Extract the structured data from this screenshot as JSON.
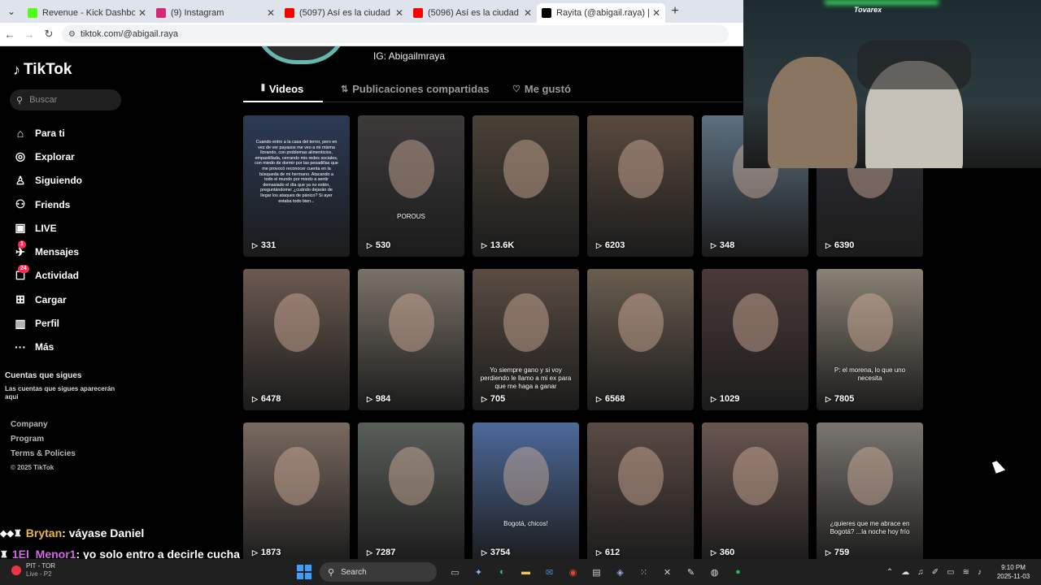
{
  "browser": {
    "tabs": [
      {
        "label": "Revenue - Kick Dashboard",
        "fav_color": "#53fc18"
      },
      {
        "label": "(9) Instagram",
        "fav_color": "#d62976"
      },
      {
        "label": "(5097) Así es la ciudad más FUTU",
        "fav_color": "#ff0000"
      },
      {
        "label": "(5096) Así es la ciudad más FUTU",
        "fav_color": "#ff0000"
      },
      {
        "label": "Rayita (@abigail.raya) | TikTok",
        "fav_color": "#000000"
      }
    ],
    "url": "tiktok.com/@abigail.raya"
  },
  "sidebar": {
    "brand": "TikTok",
    "search_placeholder": "Buscar",
    "nav": [
      {
        "label": "Para ti",
        "icon": "home-icon",
        "glyph": "⌂"
      },
      {
        "label": "Explorar",
        "icon": "compass-icon",
        "glyph": "◎"
      },
      {
        "label": "Siguiendo",
        "icon": "following-icon",
        "glyph": "♙"
      },
      {
        "label": "Friends",
        "icon": "friends-icon",
        "glyph": "⚇"
      },
      {
        "label": "LIVE",
        "icon": "live-icon",
        "glyph": "▣"
      },
      {
        "label": "Mensajes",
        "icon": "messages-icon",
        "glyph": "✈",
        "badge": "1"
      },
      {
        "label": "Actividad",
        "icon": "activity-icon",
        "glyph": "☐",
        "badge": "24"
      },
      {
        "label": "Cargar",
        "icon": "upload-icon",
        "glyph": "⊞"
      },
      {
        "label": "Perfil",
        "icon": "profile-icon",
        "glyph": "▥"
      },
      {
        "label": "Más",
        "icon": "more-icon",
        "glyph": "···"
      }
    ],
    "following_title": "Cuentas que sigues",
    "following_note": "Las cuentas que sigues aparecerán aquí",
    "footer": [
      "Company",
      "Program",
      "Terms & Policies"
    ],
    "copyright": "© 2025 TikTok"
  },
  "profile": {
    "ig_line": "IG: Abigailmraya",
    "tabs": [
      {
        "label": "Videos",
        "icon": "grid-icon",
        "glyph": "⦀"
      },
      {
        "label": "Publicaciones compartidas",
        "icon": "repost-icon",
        "glyph": "⇅"
      },
      {
        "label": "Me gustó",
        "icon": "heart-icon",
        "glyph": "♡"
      }
    ]
  },
  "videos": [
    {
      "views": "331",
      "bg": "#2b3a55",
      "text": "Cuando entro a la casa del terror, pero en vez de ver payasos me veo a mi misma llorando, con problemas alimenticios, empastillada, cerrando mis redes sociales, con miedo de dormir por las pesadillas que me provocó reconocer cuenta en la búsqueda de mi hermano. Atacando a todo el mundo por miedo a sentir demasiado el día que ya no estén, preguntándome: ¿cuándo dejarán de llegar los ataques de pánico? Si ayer estaba todo bien..."
    },
    {
      "views": "530",
      "bg": "#3d3a3a",
      "cap": "POROUS"
    },
    {
      "views": "13.6K",
      "bg": "#4a4236"
    },
    {
      "views": "6203",
      "bg": "#5a4a3e"
    },
    {
      "views": "348",
      "bg": "#5d7080"
    },
    {
      "views": "6390",
      "bg": "#2f3036"
    },
    {
      "views": "6478",
      "bg": "#6b5a50"
    },
    {
      "views": "984",
      "bg": "#7a7268"
    },
    {
      "views": "705",
      "bg": "#5a4c42",
      "cap": "Yo siempre gano y si voy perdiendo le llamo a mi ex para que me haga a ganar"
    },
    {
      "views": "6568",
      "bg": "#6a5e50"
    },
    {
      "views": "1029",
      "bg": "#4a3a38"
    },
    {
      "views": "7805",
      "bg": "#8a8275",
      "cap": "P: el morena, lo que uno necesita"
    },
    {
      "views": "1873",
      "bg": "#7a6a60"
    },
    {
      "views": "7287",
      "bg": "#5a5f5a"
    },
    {
      "views": "3754",
      "bg": "#4c6a9a",
      "cap": "Bogotá, chicos!"
    },
    {
      "views": "612",
      "bg": "#5a4a44"
    },
    {
      "views": "360",
      "bg": "#6a5650"
    },
    {
      "views": "759",
      "bg": "#7a7670",
      "cap": "¿quieres que me abrace en Bogotá? ...la noche hoy frío"
    }
  ],
  "webcam": {
    "brand": "Tovarex"
  },
  "chat": [
    {
      "user": "Brytan",
      "message": ": váyase Daniel"
    },
    {
      "user": "1El_Menor1",
      "message": ": yo solo entro a decirle cucha"
    }
  ],
  "taskbar": {
    "weather_title": "PIT - TOR",
    "weather_sub": "Live - P2",
    "search_label": "Search",
    "time": "9:10 PM",
    "date": "2025-11-03"
  }
}
